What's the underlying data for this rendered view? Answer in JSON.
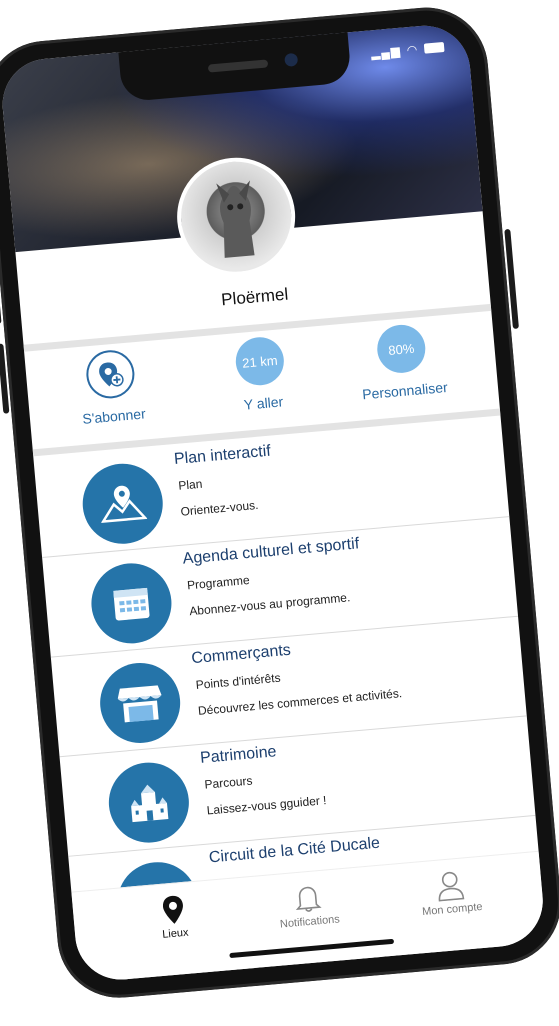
{
  "header": {
    "place_name": "Ploërmel"
  },
  "actions": [
    {
      "label": "S'abonner",
      "value": ""
    },
    {
      "label": "Y aller",
      "value": "21 km"
    },
    {
      "label": "Personnaliser",
      "value": "80%"
    }
  ],
  "items": [
    {
      "title": "Plan interactif",
      "subtitle": "Plan",
      "description": "Orientez-vous.",
      "icon": "map-icon"
    },
    {
      "title": "Agenda culturel et sportif",
      "subtitle": "Programme",
      "description": "Abonnez-vous au programme.",
      "icon": "calendar-icon"
    },
    {
      "title": "Commerçants",
      "subtitle": "Points d'intérêts",
      "description": "Découvrez les commerces et activités.",
      "icon": "shop-icon"
    },
    {
      "title": "Patrimoine",
      "subtitle": "Parcours",
      "description": "Laissez-vous gguider !",
      "icon": "castle-icon"
    },
    {
      "title": "Circuit de la Cité Ducale",
      "subtitle": "",
      "description": "",
      "icon": "circuit-icon"
    }
  ],
  "tabs": [
    {
      "label": "Lieux",
      "icon": "location-pin-icon",
      "active": true
    },
    {
      "label": "Notifications",
      "icon": "bell-icon",
      "active": false
    },
    {
      "label": "Mon compte",
      "icon": "user-icon",
      "active": false
    }
  ],
  "colors": {
    "primary": "#2574a9",
    "accent_light": "#7cb9e8",
    "title": "#1c3f6e"
  }
}
